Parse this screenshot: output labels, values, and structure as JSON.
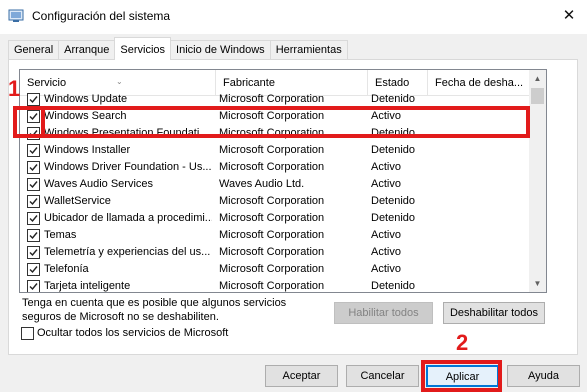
{
  "window": {
    "title": "Configuración del sistema",
    "close_glyph": "✕"
  },
  "tabs": [
    {
      "label": "General",
      "active": false
    },
    {
      "label": "Arranque",
      "active": false
    },
    {
      "label": "Servicios",
      "active": true
    },
    {
      "label": "Inicio de Windows",
      "active": false
    },
    {
      "label": "Herramientas",
      "active": false
    }
  ],
  "table": {
    "columns": [
      "Servicio",
      "Fabricante",
      "Estado",
      "Fecha de desha..."
    ],
    "rows": [
      {
        "name": "Windows Update",
        "maker": "Microsoft Corporation",
        "status": "Detenido",
        "checked": true
      },
      {
        "name": "Windows Search",
        "maker": "Microsoft Corporation",
        "status": "Activo",
        "checked": true
      },
      {
        "name": "Windows Presentation Foundati...",
        "maker": "Microsoft Corporation",
        "status": "Detenido",
        "checked": true
      },
      {
        "name": "Windows Installer",
        "maker": "Microsoft Corporation",
        "status": "Detenido",
        "checked": true
      },
      {
        "name": "Windows Driver Foundation - Us...",
        "maker": "Microsoft Corporation",
        "status": "Activo",
        "checked": true
      },
      {
        "name": "Waves Audio Services",
        "maker": "Waves Audio Ltd.",
        "status": "Activo",
        "checked": true
      },
      {
        "name": "WalletService",
        "maker": "Microsoft Corporation",
        "status": "Detenido",
        "checked": true
      },
      {
        "name": "Ubicador de llamada a procedimi...",
        "maker": "Microsoft Corporation",
        "status": "Detenido",
        "checked": true
      },
      {
        "name": "Temas",
        "maker": "Microsoft Corporation",
        "status": "Activo",
        "checked": true
      },
      {
        "name": "Telemetría y experiencias del us...",
        "maker": "Microsoft Corporation",
        "status": "Activo",
        "checked": true
      },
      {
        "name": "Telefonía",
        "maker": "Microsoft Corporation",
        "status": "Activo",
        "checked": true
      },
      {
        "name": "Tarjeta inteligente",
        "maker": "Microsoft Corporation",
        "status": "Detenido",
        "checked": true
      }
    ]
  },
  "note": "Tenga en cuenta que es posible que algunos servicios seguros de Microsoft no se deshabiliten.",
  "buttons": {
    "enable_all": "Habilitar todos",
    "disable_all": "Deshabilitar todos",
    "accept": "Aceptar",
    "cancel": "Cancelar",
    "apply": "Aplicar",
    "help": "Ayuda"
  },
  "hide_ms_label": "Ocultar todos los servicios de Microsoft",
  "annotations": {
    "one": "1",
    "two": "2",
    "color": "#e21b1b"
  },
  "icons": {
    "app": "system-config-icon",
    "checkmark": "checkmark-icon",
    "close": "close-icon"
  }
}
